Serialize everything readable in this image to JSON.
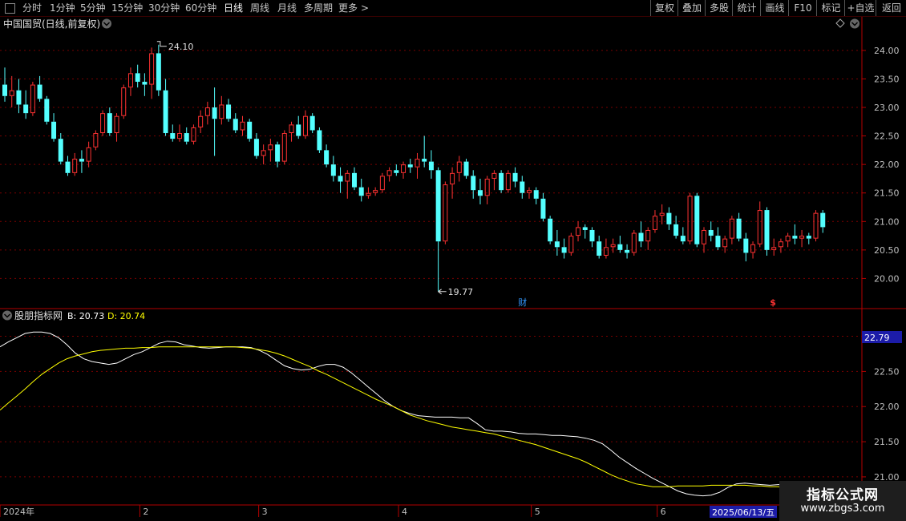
{
  "toolbar": {
    "periods": [
      {
        "label": "分时"
      },
      {
        "label": "1分钟"
      },
      {
        "label": "5分钟"
      },
      {
        "label": "15分钟"
      },
      {
        "label": "30分钟"
      },
      {
        "label": "60分钟"
      },
      {
        "label": "日线",
        "active": true
      },
      {
        "label": "周线"
      },
      {
        "label": "月线"
      },
      {
        "label": "多周期"
      },
      {
        "label": "更多"
      }
    ],
    "more_arrow": ">",
    "right_buttons": [
      {
        "label": "复权"
      },
      {
        "label": "叠加"
      },
      {
        "label": "多股"
      },
      {
        "label": "统计"
      },
      {
        "label": "画线"
      },
      {
        "label": "F10"
      },
      {
        "label": "标记"
      },
      {
        "label": "+自选"
      },
      {
        "label": "返回"
      }
    ]
  },
  "main_panel": {
    "title": "中国国贸(日线,前复权)",
    "high_label": "24.10",
    "low_label": "19.77",
    "event_marks": [
      {
        "label": "财",
        "color": "#3399ff",
        "x_index": 74
      },
      {
        "label": "$",
        "color": "#ff3333",
        "x_index": 110
      }
    ]
  },
  "indicator_panel": {
    "title": "股朋指标网",
    "b_label": "B: 20.73",
    "d_label": "D: 20.74",
    "current_value_box": "22.79"
  },
  "x_axis": {
    "labels": [
      {
        "label": "2024年",
        "index": 0
      },
      {
        "label": "2",
        "index": 20
      },
      {
        "label": "3",
        "index": 37
      },
      {
        "label": "4",
        "index": 57
      },
      {
        "label": "5",
        "index": 76
      },
      {
        "label": "6",
        "index": 94
      }
    ],
    "cursor_date": "2025/06/13/五"
  },
  "watermark": {
    "title": "指标公式网",
    "url": "www.zbgs3.com"
  },
  "colors": {
    "up": "#ff3232",
    "down": "#54ffff",
    "b_line": "#ffffff",
    "d_line": "#ffff00",
    "grid": "#7a0000",
    "frame": "#b40000"
  },
  "chart_data": [
    {
      "type": "candlestick",
      "title": "中国国贸(日线,前复权)",
      "ylim": [
        19.5,
        24.35
      ],
      "y_ticks": [
        20.0,
        20.5,
        21.0,
        21.5,
        22.0,
        22.5,
        23.0,
        23.5,
        24.0
      ],
      "high_marker": 24.1,
      "low_marker": 19.77,
      "ohlc": [
        [
          23.4,
          23.7,
          23.1,
          23.2
        ],
        [
          23.2,
          23.55,
          23.0,
          23.3
        ],
        [
          23.3,
          23.5,
          22.9,
          23.05
        ],
        [
          23.05,
          23.3,
          22.8,
          22.9
        ],
        [
          22.9,
          23.45,
          22.85,
          23.4
        ],
        [
          23.4,
          23.55,
          23.1,
          23.15
        ],
        [
          23.15,
          23.2,
          22.7,
          22.75
        ],
        [
          22.75,
          22.9,
          22.4,
          22.45
        ],
        [
          22.45,
          22.55,
          22.0,
          22.05
        ],
        [
          22.05,
          22.15,
          21.8,
          21.85
        ],
        [
          21.85,
          22.2,
          21.8,
          22.1
        ],
        [
          22.1,
          22.25,
          21.85,
          22.05
        ],
        [
          22.05,
          22.4,
          21.95,
          22.3
        ],
        [
          22.3,
          22.6,
          22.25,
          22.55
        ],
        [
          22.55,
          22.95,
          22.5,
          22.9
        ],
        [
          22.9,
          23.0,
          22.5,
          22.55
        ],
        [
          22.55,
          22.9,
          22.4,
          22.85
        ],
        [
          22.85,
          23.4,
          22.8,
          23.35
        ],
        [
          23.35,
          23.7,
          23.2,
          23.6
        ],
        [
          23.6,
          23.75,
          23.35,
          23.45
        ],
        [
          23.45,
          23.6,
          23.2,
          23.4
        ],
        [
          23.4,
          24.05,
          23.15,
          23.95
        ],
        [
          23.95,
          24.1,
          23.2,
          23.3
        ],
        [
          23.3,
          23.5,
          22.5,
          22.55
        ],
        [
          22.55,
          22.7,
          22.4,
          22.45
        ],
        [
          22.45,
          22.7,
          22.4,
          22.55
        ],
        [
          22.55,
          22.65,
          22.35,
          22.4
        ],
        [
          22.4,
          22.7,
          22.35,
          22.65
        ],
        [
          22.65,
          22.95,
          22.55,
          22.85
        ],
        [
          22.85,
          23.1,
          22.7,
          23.0
        ],
        [
          23.0,
          23.35,
          22.15,
          22.8
        ],
        [
          22.8,
          23.2,
          22.7,
          23.05
        ],
        [
          23.05,
          23.15,
          22.75,
          22.8
        ],
        [
          22.8,
          22.9,
          22.55,
          22.6
        ],
        [
          22.6,
          22.85,
          22.5,
          22.75
        ],
        [
          22.75,
          22.8,
          22.4,
          22.45
        ],
        [
          22.45,
          22.55,
          22.1,
          22.15
        ],
        [
          22.15,
          22.35,
          22.0,
          22.25
        ],
        [
          22.25,
          22.45,
          22.05,
          22.35
        ],
        [
          22.35,
          22.4,
          21.95,
          22.05
        ],
        [
          22.05,
          22.6,
          22.0,
          22.55
        ],
        [
          22.55,
          22.75,
          22.4,
          22.7
        ],
        [
          22.7,
          22.85,
          22.45,
          22.5
        ],
        [
          22.5,
          22.95,
          22.45,
          22.85
        ],
        [
          22.85,
          22.9,
          22.55,
          22.6
        ],
        [
          22.6,
          22.65,
          22.2,
          22.25
        ],
        [
          22.25,
          22.35,
          21.95,
          22.0
        ],
        [
          22.0,
          22.15,
          21.7,
          21.8
        ],
        [
          21.8,
          21.95,
          21.5,
          21.7
        ],
        [
          21.7,
          21.9,
          21.4,
          21.85
        ],
        [
          21.85,
          21.95,
          21.55,
          21.6
        ],
        [
          21.6,
          21.75,
          21.35,
          21.45
        ],
        [
          21.45,
          21.6,
          21.4,
          21.5
        ],
        [
          21.5,
          21.6,
          21.45,
          21.55
        ],
        [
          21.55,
          21.85,
          21.5,
          21.8
        ],
        [
          21.8,
          21.95,
          21.7,
          21.9
        ],
        [
          21.9,
          22.0,
          21.8,
          21.85
        ],
        [
          21.85,
          22.05,
          21.75,
          22.0
        ],
        [
          22.0,
          22.1,
          21.85,
          21.95
        ],
        [
          21.95,
          22.2,
          21.75,
          22.1
        ],
        [
          22.1,
          22.5,
          21.95,
          22.05
        ],
        [
          22.05,
          22.25,
          21.75,
          21.9
        ],
        [
          21.9,
          21.95,
          19.77,
          20.65
        ],
        [
          20.65,
          21.7,
          20.6,
          21.65
        ],
        [
          21.65,
          21.95,
          21.4,
          21.85
        ],
        [
          21.85,
          22.15,
          21.7,
          22.05
        ],
        [
          22.05,
          22.1,
          21.75,
          21.8
        ],
        [
          21.8,
          21.9,
          21.4,
          21.55
        ],
        [
          21.55,
          21.75,
          21.3,
          21.45
        ],
        [
          21.45,
          21.8,
          21.3,
          21.75
        ],
        [
          21.75,
          21.9,
          21.55,
          21.85
        ],
        [
          21.85,
          21.9,
          21.5,
          21.55
        ],
        [
          21.55,
          21.9,
          21.5,
          21.85
        ],
        [
          21.85,
          21.95,
          21.6,
          21.7
        ],
        [
          21.7,
          21.8,
          21.4,
          21.5
        ],
        [
          21.5,
          21.6,
          21.4,
          21.55
        ],
        [
          21.55,
          21.6,
          21.3,
          21.4
        ],
        [
          21.4,
          21.5,
          21.0,
          21.05
        ],
        [
          21.05,
          21.1,
          20.6,
          20.65
        ],
        [
          20.65,
          20.85,
          20.4,
          20.55
        ],
        [
          20.55,
          20.7,
          20.35,
          20.45
        ],
        [
          20.45,
          20.8,
          20.4,
          20.75
        ],
        [
          20.75,
          21.0,
          20.65,
          20.9
        ],
        [
          20.9,
          20.95,
          20.7,
          20.85
        ],
        [
          20.85,
          20.9,
          20.55,
          20.65
        ],
        [
          20.65,
          20.75,
          20.35,
          20.4
        ],
        [
          20.4,
          20.7,
          20.35,
          20.55
        ],
        [
          20.55,
          20.7,
          20.45,
          20.6
        ],
        [
          20.6,
          20.75,
          20.45,
          20.5
        ],
        [
          20.5,
          20.6,
          20.35,
          20.45
        ],
        [
          20.45,
          20.85,
          20.4,
          20.8
        ],
        [
          20.8,
          21.0,
          20.55,
          20.65
        ],
        [
          20.65,
          20.9,
          20.5,
          20.85
        ],
        [
          20.85,
          21.2,
          20.8,
          21.1
        ],
        [
          21.1,
          21.3,
          20.95,
          21.15
        ],
        [
          21.15,
          21.25,
          20.85,
          20.95
        ],
        [
          20.95,
          21.1,
          20.7,
          20.75
        ],
        [
          20.75,
          20.9,
          20.6,
          20.65
        ],
        [
          20.65,
          21.5,
          20.6,
          21.45
        ],
        [
          21.45,
          21.5,
          20.55,
          20.6
        ],
        [
          20.6,
          20.9,
          20.45,
          20.85
        ],
        [
          20.85,
          21.0,
          20.65,
          20.75
        ],
        [
          20.75,
          20.9,
          20.5,
          20.55
        ],
        [
          20.55,
          20.75,
          20.45,
          20.7
        ],
        [
          20.7,
          21.1,
          20.6,
          21.05
        ],
        [
          21.05,
          21.15,
          20.65,
          20.7
        ],
        [
          20.7,
          20.8,
          20.3,
          20.45
        ],
        [
          20.45,
          20.65,
          20.35,
          20.6
        ],
        [
          20.6,
          21.35,
          20.55,
          21.2
        ],
        [
          21.2,
          21.25,
          20.4,
          20.5
        ],
        [
          20.5,
          20.7,
          20.4,
          20.55
        ],
        [
          20.55,
          20.7,
          20.45,
          20.65
        ],
        [
          20.65,
          20.8,
          20.55,
          20.75
        ],
        [
          20.75,
          20.95,
          20.6,
          20.7
        ],
        [
          20.7,
          20.85,
          20.55,
          20.75
        ],
        [
          20.75,
          20.8,
          20.6,
          20.7
        ],
        [
          20.7,
          21.2,
          20.65,
          21.15
        ],
        [
          21.15,
          21.2,
          20.8,
          20.9
        ]
      ]
    },
    {
      "type": "line",
      "title": "股朋指标网",
      "ylim": [
        20.6,
        23.2
      ],
      "y_ticks": [
        21.0,
        21.5,
        22.0,
        22.5,
        23.0
      ],
      "series": [
        {
          "name": "B",
          "color": "#ffffff",
          "values": [
            22.85,
            22.92,
            22.98,
            23.04,
            23.06,
            23.06,
            23.04,
            22.98,
            22.88,
            22.76,
            22.68,
            22.64,
            22.62,
            22.6,
            22.62,
            22.68,
            22.74,
            22.78,
            22.84,
            22.9,
            22.93,
            22.92,
            22.88,
            22.86,
            22.84,
            22.83,
            22.84,
            22.85,
            22.85,
            22.85,
            22.84,
            22.8,
            22.74,
            22.66,
            22.58,
            22.54,
            22.52,
            22.53,
            22.57,
            22.6,
            22.6,
            22.56,
            22.48,
            22.38,
            22.28,
            22.18,
            22.08,
            22.0,
            21.94,
            21.9,
            21.87,
            21.86,
            21.85,
            21.85,
            21.85,
            21.84,
            21.84,
            21.76,
            21.67,
            21.65,
            21.65,
            21.64,
            21.62,
            21.61,
            21.61,
            21.6,
            21.59,
            21.59,
            21.58,
            21.57,
            21.55,
            21.52,
            21.47,
            21.38,
            21.28,
            21.2,
            21.12,
            21.05,
            20.98,
            20.92,
            20.86,
            20.8,
            20.76,
            20.74,
            20.73,
            20.74,
            20.78,
            20.85,
            20.9,
            20.91,
            20.9,
            20.89,
            20.88,
            20.89,
            20.89,
            20.88,
            20.87,
            20.86,
            20.84,
            20.82,
            20.8,
            20.8,
            20.8,
            20.8
          ]
        },
        {
          "name": "D",
          "color": "#ffff00",
          "values": [
            21.95,
            22.05,
            22.15,
            22.25,
            22.36,
            22.46,
            22.54,
            22.62,
            22.68,
            22.72,
            22.75,
            22.78,
            22.8,
            22.81,
            22.82,
            22.83,
            22.83,
            22.84,
            22.84,
            22.85,
            22.85,
            22.85,
            22.85,
            22.85,
            22.85,
            22.85,
            22.85,
            22.85,
            22.85,
            22.84,
            22.83,
            22.81,
            22.79,
            22.76,
            22.72,
            22.67,
            22.62,
            22.57,
            22.51,
            22.46,
            22.4,
            22.34,
            22.28,
            22.22,
            22.16,
            22.1,
            22.05,
            22.0,
            21.94,
            21.88,
            21.84,
            21.8,
            21.77,
            21.74,
            21.71,
            21.69,
            21.67,
            21.65,
            21.63,
            21.61,
            21.58,
            21.55,
            21.52,
            21.49,
            21.46,
            21.42,
            21.38,
            21.34,
            21.3,
            21.26,
            21.21,
            21.15,
            21.09,
            21.03,
            20.98,
            20.94,
            20.9,
            20.88,
            20.86,
            20.86,
            20.86,
            20.87,
            20.87,
            20.87,
            20.87,
            20.88,
            20.88,
            20.88,
            20.88,
            20.88,
            20.87,
            20.87,
            20.86,
            20.86,
            20.85,
            20.84,
            20.83,
            20.82,
            20.81,
            20.8,
            20.79,
            20.78,
            20.77,
            20.76
          ]
        }
      ]
    }
  ]
}
